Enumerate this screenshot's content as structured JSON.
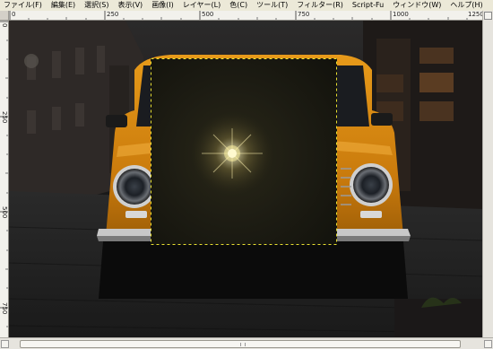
{
  "menubar": {
    "items": [
      {
        "label": "ファイル(F)"
      },
      {
        "label": "編集(E)"
      },
      {
        "label": "選択(S)"
      },
      {
        "label": "表示(V)"
      },
      {
        "label": "画像(I)"
      },
      {
        "label": "レイヤー(L)"
      },
      {
        "label": "色(C)"
      },
      {
        "label": "ツール(T)"
      },
      {
        "label": "フィルター(R)"
      },
      {
        "label": "Script-Fu"
      },
      {
        "label": "ウィンドウ(W)"
      },
      {
        "label": "ヘルプ(H)"
      }
    ]
  },
  "rulers": {
    "horizontal_labels": [
      "0",
      "250",
      "500",
      "750",
      "1000",
      "1250"
    ],
    "vertical_labels": [
      "0",
      "250",
      "500",
      "750"
    ]
  },
  "canvas": {
    "content": "photo-of-orange-car-with-selected-dark-layer",
    "layer_selection": "active-layer-with-lens-flare"
  },
  "colors": {
    "car_body": "#d98a12",
    "layer_bg": "#1a1a12",
    "flare": "#fffbe0",
    "selection_marquee": "#e8e030"
  }
}
